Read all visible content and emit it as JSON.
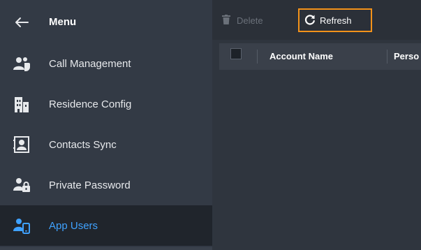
{
  "sidebar": {
    "title": "Menu",
    "back_icon": "arrow-left-icon",
    "items": [
      {
        "label": "Call Management",
        "icon": "call-users-icon",
        "active": false
      },
      {
        "label": "Residence Config",
        "icon": "building-icon",
        "active": false
      },
      {
        "label": "Contacts Sync",
        "icon": "contact-card-icon",
        "active": false
      },
      {
        "label": "Private Password",
        "icon": "user-lock-icon",
        "active": false
      },
      {
        "label": "App Users",
        "icon": "user-phone-icon",
        "active": true
      }
    ]
  },
  "toolbar": {
    "delete_label": "Delete",
    "refresh_label": "Refresh"
  },
  "table": {
    "columns": [
      "Account Name",
      "Perso"
    ]
  },
  "colors": {
    "accent": "#3fa2ff",
    "highlight": "#f3921a",
    "sidebar_bg": "#333a45",
    "active_bg": "#20252c"
  }
}
